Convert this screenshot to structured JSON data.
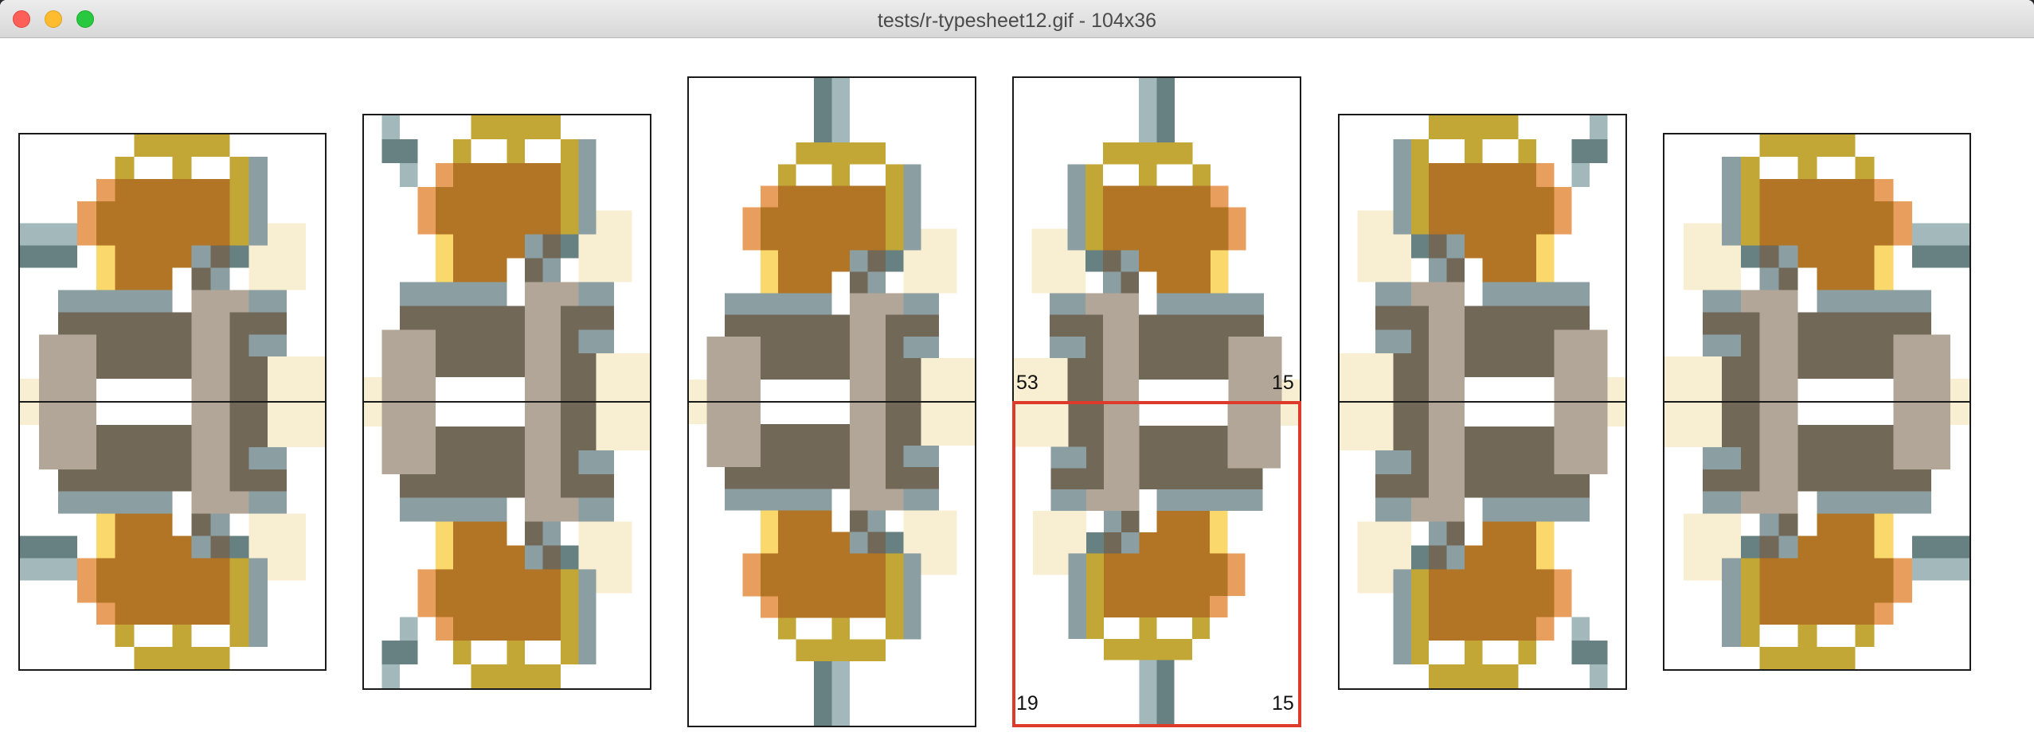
{
  "window": {
    "title": "tests/r-typesheet12.gif - 104x36",
    "buttons": [
      "close",
      "minimize",
      "zoom"
    ]
  },
  "colors": {
    "brown": "#b27525",
    "gold": "#c2a636",
    "orange": "#e89e5c",
    "yellow": "#fbd86b",
    "cream": "#f8efd3",
    "taupe": "#b1a697",
    "dark": "#726858",
    "slate": "#8b9ea2",
    "slatedark": "#678082",
    "slatelight": "#a2b8ba",
    "selection": "#dd3a2c",
    "frame": "#1a1a1a"
  },
  "sprites": [
    {
      "row": 1,
      "col": 1,
      "variant": "top-side-left",
      "selected": false
    },
    {
      "row": 1,
      "col": 2,
      "variant": "top-diag-left",
      "selected": false
    },
    {
      "row": 1,
      "col": 3,
      "variant": "top-up-left",
      "selected": false
    },
    {
      "row": 1,
      "col": 4,
      "variant": "top-up-right",
      "selected": false
    },
    {
      "row": 1,
      "col": 5,
      "variant": "top-diag-right",
      "selected": false
    },
    {
      "row": 1,
      "col": 6,
      "variant": "top-side-right",
      "selected": false
    },
    {
      "row": 2,
      "col": 1,
      "variant": "bottom-side-left",
      "selected": false
    },
    {
      "row": 2,
      "col": 2,
      "variant": "bottom-diag-left",
      "selected": false
    },
    {
      "row": 2,
      "col": 3,
      "variant": "bottom-down-left",
      "selected": false
    },
    {
      "row": 2,
      "col": 4,
      "variant": "bottom-down-right",
      "selected": true
    },
    {
      "row": 2,
      "col": 5,
      "variant": "bottom-diag-right",
      "selected": false
    },
    {
      "row": 2,
      "col": 6,
      "variant": "bottom-side-right",
      "selected": false
    }
  ],
  "selection": {
    "top_left": "53",
    "top_right": "15",
    "bottom_left": "19",
    "bottom_right": "15"
  }
}
